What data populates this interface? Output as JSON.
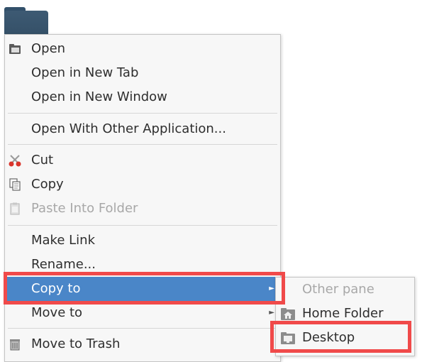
{
  "context_menu": {
    "items": [
      {
        "label": "Open",
        "icon": "open-icon"
      },
      {
        "label": "Open in New Tab"
      },
      {
        "label": "Open in New Window"
      },
      {
        "label": "Open With Other Application..."
      },
      {
        "label": "Cut",
        "icon": "scissors-icon"
      },
      {
        "label": "Copy",
        "icon": "copy-icon"
      },
      {
        "label": "Paste Into Folder",
        "icon": "clipboard-icon",
        "disabled": true
      },
      {
        "label": "Make Link"
      },
      {
        "label": "Rename..."
      },
      {
        "label": "Copy to",
        "submenu": true,
        "active": true
      },
      {
        "label": "Move to",
        "submenu": true
      },
      {
        "label": "Move to Trash",
        "icon": "trash-icon"
      }
    ]
  },
  "copy_to_submenu": {
    "items": [
      {
        "label": "Other pane",
        "disabled": true
      },
      {
        "label": "Home Folder",
        "icon": "home-folder-icon"
      },
      {
        "label": "Desktop",
        "icon": "desktop-folder-icon"
      }
    ]
  },
  "colors": {
    "highlight_border": "#f04a4a",
    "active_item_bg": "#4a86c8",
    "menu_bg": "#f7f7f7"
  }
}
